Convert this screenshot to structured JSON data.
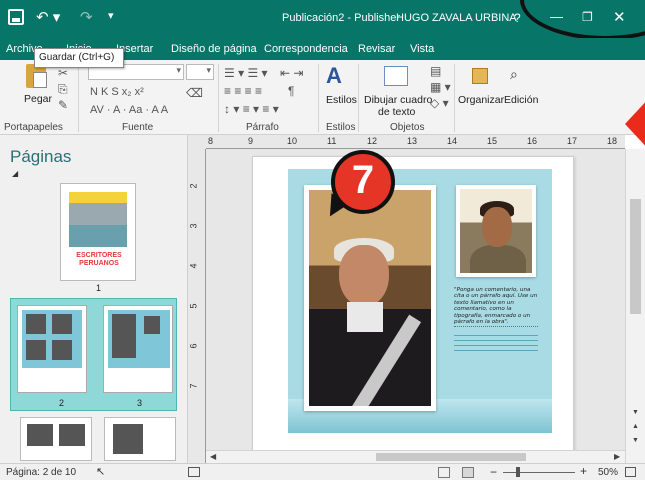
{
  "titlebar": {
    "document_title": "Publicación2 - Publisher",
    "user_name": "HUGO ZAVALA URBINA",
    "help": "?",
    "minimize": "—",
    "restore": "❐",
    "close": "✕"
  },
  "tooltip": {
    "text": "Guardar (Ctrl+G)"
  },
  "tabs": [
    {
      "label": "Archivo"
    },
    {
      "label": "Inicio"
    },
    {
      "label": "Insertar"
    },
    {
      "label": "Diseño de página"
    },
    {
      "label": "Correspondencia"
    },
    {
      "label": "Revisar"
    },
    {
      "label": "Vista"
    }
  ],
  "ribbon": {
    "groups": {
      "portapapeles": "Portapapeles",
      "fuente": "Fuente",
      "parrafo": "Párrafo",
      "estilos": "Estilos",
      "objetos": "Objetos"
    },
    "paste_label": "Pegar",
    "font_row2": "N  K  S  x₂  x²",
    "font_row3": "AV ·  A · Aa ·  A  A",
    "styles_label": "Estilos",
    "draw_textbox_label": "Dibujar cuadro",
    "draw_textbox_label2": "de texto",
    "organize_label": "Organizar",
    "edit_label": "Edición"
  },
  "pages_pane": {
    "title": "Páginas",
    "thumb1_text": "ESCRITORES PERUANOS",
    "thumb_numbers": [
      "1",
      "2",
      "3"
    ]
  },
  "ruler": {
    "h_labels": [
      "8",
      "9",
      "10",
      "11",
      "12",
      "13",
      "14",
      "15",
      "16",
      "17",
      "18"
    ],
    "v_labels": [
      "2",
      "3",
      "4",
      "5",
      "6",
      "7"
    ]
  },
  "document": {
    "quote_text": "\"Ponga un comentario, una cita o un párrafo aquí. Use un texto llamativo en un comentario, como la tipografía, enmarcado o un párrafo en la obra\"."
  },
  "badge": {
    "number": "7"
  },
  "status": {
    "page": "Página: 2 de 10",
    "zoom": "50%"
  },
  "colors": {
    "titlebar": "#077568",
    "spread_bg": "#a8dbe4",
    "badge": "#e43526",
    "selection": "#8fd8d8"
  }
}
